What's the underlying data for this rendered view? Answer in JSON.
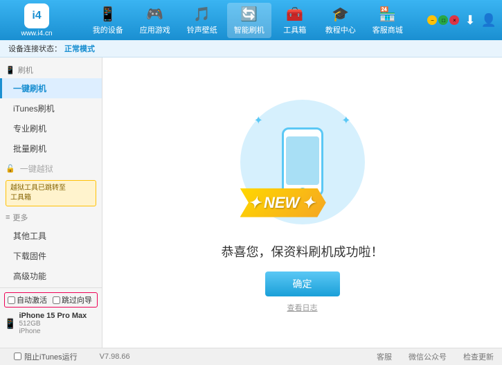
{
  "logo": {
    "icon_text": "i4",
    "url_text": "www.i4.cn"
  },
  "nav": {
    "items": [
      {
        "id": "my-device",
        "icon": "📱",
        "label": "我的设备",
        "active": false
      },
      {
        "id": "app-games",
        "icon": "🎮",
        "label": "应用游戏",
        "active": false
      },
      {
        "id": "ringtone",
        "icon": "🎵",
        "label": "铃声壁纸",
        "active": false
      },
      {
        "id": "smart-flash",
        "icon": "🔄",
        "label": "智能刷机",
        "active": true
      },
      {
        "id": "toolbox",
        "icon": "🧰",
        "label": "工具箱",
        "active": false
      },
      {
        "id": "tutorial",
        "icon": "🎓",
        "label": "教程中心",
        "active": false
      },
      {
        "id": "service",
        "icon": "🏪",
        "label": "客服商城",
        "active": false
      }
    ]
  },
  "topbar_right": {
    "download_icon": "⬇",
    "user_icon": "👤"
  },
  "win_controls": {
    "min": "−",
    "max": "□",
    "close": "×"
  },
  "statusbar": {
    "prefix": "设备连接状态：",
    "mode": "正常模式"
  },
  "sidebar": {
    "section_flash": {
      "header_icon": "📱",
      "header_label": "刷机",
      "items": [
        {
          "id": "one-key-flash",
          "label": "一键刷机",
          "active": true
        },
        {
          "id": "itunes-flash",
          "label": "iTunes刷机",
          "active": false
        },
        {
          "id": "pro-flash",
          "label": "专业刷机",
          "active": false
        },
        {
          "id": "batch-flash",
          "label": "批量刷机",
          "active": false
        }
      ]
    },
    "section_jailbreak": {
      "header_icon": "🔓",
      "header_label": "一键越狱",
      "disabled": true,
      "notice": "越狱工具已跳转至\n工具箱"
    },
    "section_more": {
      "header_label": "更多",
      "items": [
        {
          "id": "other-tools",
          "label": "其他工具"
        },
        {
          "id": "download-firmware",
          "label": "下载固件"
        },
        {
          "id": "advanced",
          "label": "高级功能"
        }
      ]
    }
  },
  "content": {
    "new_label": "NEW",
    "new_stars": "✦",
    "success_text": "恭喜您，保资料刷机成功啦！",
    "confirm_button": "确定",
    "view_log": "查看日志"
  },
  "device": {
    "auto_activate_label": "自动激活",
    "guide_label": "跳过向导",
    "icon": "📱",
    "name": "iPhone 15 Pro Max",
    "storage": "512GB",
    "type": "iPhone"
  },
  "footer": {
    "version": "V7.98.66",
    "items": [
      {
        "id": "qq",
        "label": "客服"
      },
      {
        "id": "wechat",
        "label": "微信公众号"
      },
      {
        "id": "check-update",
        "label": "检查更新"
      }
    ],
    "itunes_label": "阻止iTunes运行"
  }
}
